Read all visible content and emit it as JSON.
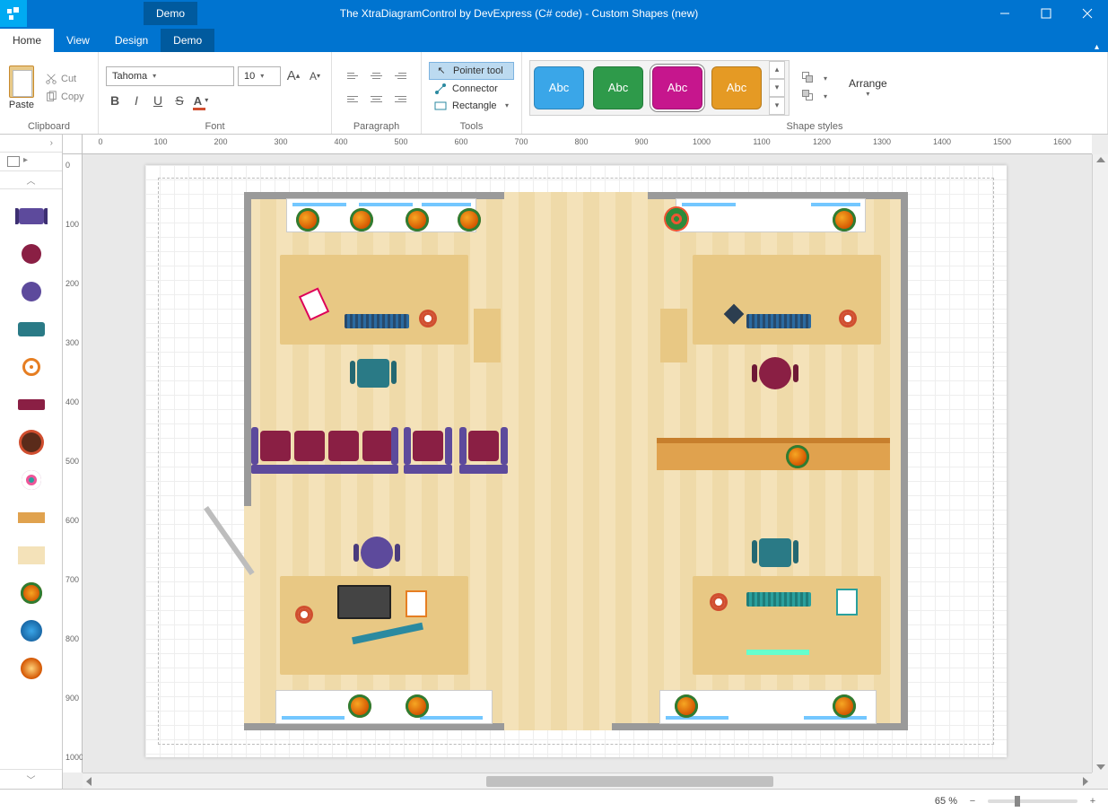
{
  "titlebar": {
    "contextual_tab": "Demo",
    "title": "The XtraDiagramControl by DevExpress (C# code) - Custom Shapes (new)"
  },
  "tabs": {
    "home": "Home",
    "view": "View",
    "design": "Design",
    "demo": "Demo",
    "active": "Home"
  },
  "ribbon": {
    "clipboard": {
      "label": "Clipboard",
      "paste": "Paste",
      "cut": "Cut",
      "copy": "Copy"
    },
    "font": {
      "label": "Font",
      "family": "Tahoma",
      "size": "10"
    },
    "paragraph": {
      "label": "Paragraph"
    },
    "tools": {
      "label": "Tools",
      "pointer": "Pointer tool",
      "connector": "Connector",
      "rectangle": "Rectangle"
    },
    "styles": {
      "label": "Shape styles",
      "sample_text": "Abc",
      "swatches": [
        {
          "color": "#3aa6e8",
          "selected": false
        },
        {
          "color": "#2e9a4a",
          "selected": false
        },
        {
          "color": "#c6168d",
          "selected": true
        },
        {
          "color": "#e59a24",
          "selected": false
        }
      ]
    },
    "arrange": {
      "label": "Arrange"
    }
  },
  "ruler": {
    "h": [
      "0",
      "100",
      "200",
      "300",
      "400",
      "500",
      "600",
      "700",
      "800",
      "900",
      "1000",
      "1100",
      "1200",
      "1300",
      "1400",
      "1500",
      "1600"
    ],
    "v": [
      "0",
      "100",
      "200",
      "300",
      "400",
      "500",
      "600",
      "700",
      "800",
      "900",
      "1000"
    ]
  },
  "stencil_icons": [
    "armchair-purple",
    "chair-red-round",
    "chair-purple-round",
    "sofa-teal",
    "target-orange",
    "sofa-maroon",
    "coffee-cup",
    "record-teal",
    "desk-orange",
    "desk-cream",
    "salad-plate",
    "globe",
    "autumn-plate"
  ],
  "status": {
    "zoom_text": "65 %"
  }
}
